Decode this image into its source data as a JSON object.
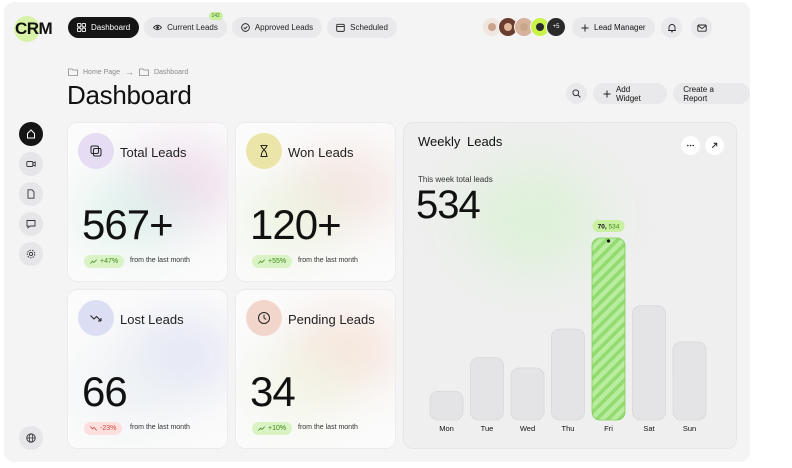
{
  "app": {
    "logo": "CRM"
  },
  "nav": {
    "tabs": [
      {
        "label": "Dashboard",
        "icon": "grid-icon",
        "active": true
      },
      {
        "label": "Current Leads",
        "icon": "eye-icon",
        "badge": "142"
      },
      {
        "label": "Approved Leads",
        "icon": "check-circle-icon"
      },
      {
        "label": "Scheduled",
        "icon": "calendar-icon"
      }
    ]
  },
  "team": {
    "extra_count": "+5"
  },
  "header": {
    "lead_manager_label": "Lead Manager"
  },
  "breadcrumb": {
    "home": "Home Page",
    "current": "Dashboard"
  },
  "page": {
    "title": "Dashboard"
  },
  "actions": {
    "add_widget": "Add Widget",
    "create_report": "Create a Report"
  },
  "stats": [
    {
      "label": "Total Leads",
      "value": "567+",
      "change": "+47%",
      "direction": "up",
      "note": "from the last month",
      "icon": "copy-icon",
      "icon_bg": "#e6dcf3"
    },
    {
      "label": "Won Leads",
      "value": "120+",
      "change": "+55%",
      "direction": "up",
      "note": "from the last month",
      "icon": "hourglass-icon",
      "icon_bg": "#ece5a8"
    },
    {
      "label": "Lost Leads",
      "value": "66",
      "change": "-23%",
      "direction": "down",
      "note": "from the last month",
      "icon": "trend-down-icon",
      "icon_bg": "#dcdff4"
    },
    {
      "label": "Pending Leads",
      "value": "34",
      "change": "+10%",
      "direction": "up",
      "note": "from the last month",
      "icon": "clock-icon",
      "icon_bg": "#f2d6cc"
    }
  ],
  "weekly": {
    "title": "Weekly  Leads",
    "subtitle": "This week total leads",
    "total": "534",
    "tooltip_value": "70",
    "tooltip_total": "534"
  },
  "chart_data": {
    "type": "bar",
    "title": "Weekly  Leads",
    "categories": [
      "Mon",
      "Tue",
      "Wed",
      "Thu",
      "Fri",
      "Sat",
      "Sun"
    ],
    "values": [
      11,
      24,
      20,
      35,
      70,
      44,
      30
    ],
    "highlight_index": 4,
    "highlight_color": "#a9e58c",
    "bar_color": "#e4e4e6",
    "ylim": [
      0,
      70
    ],
    "grid": false
  }
}
